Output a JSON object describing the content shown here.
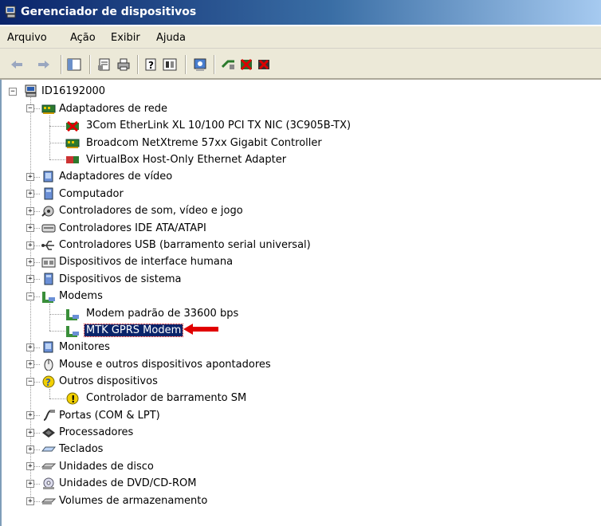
{
  "window": {
    "title": "Gerenciador de dispositivos"
  },
  "menu": [
    "Arquivo",
    "Ação",
    "Exibir",
    "Ajuda"
  ],
  "toolbar": [
    "back-icon",
    "forward-icon",
    "show-hide-icon",
    "properties-icon",
    "print-icon",
    "help-icon",
    "view-icon",
    "scan-hardware-icon",
    "update-driver-icon",
    "disable-icon",
    "uninstall-icon"
  ],
  "tree": {
    "root": "ID16192000",
    "net": {
      "label": "Adaptadores de rede",
      "children": [
        "3Com EtherLink XL 10/100 PCI TX NIC (3C905B-TX)",
        "Broadcom NetXtreme 57xx Gigabit Controller",
        "VirtualBox Host-Only Ethernet Adapter"
      ]
    },
    "video": "Adaptadores de vídeo",
    "computer": "Computador",
    "sound": "Controladores de som, vídeo e jogo",
    "ide": "Controladores IDE ATA/ATAPI",
    "usb": "Controladores USB (barramento serial universal)",
    "hid": "Dispositivos de interface humana",
    "system": "Dispositivos de sistema",
    "modems": {
      "label": "Modems",
      "children": [
        "Modem padrão de 33600 bps",
        "MTK GPRS Modem"
      ]
    },
    "monitors": "Monitores",
    "mouse": "Mouse e outros dispositivos apontadores",
    "other": {
      "label": "Outros dispositivos",
      "children": [
        "Controlador de barramento SM"
      ]
    },
    "ports": "Portas (COM & LPT)",
    "cpu": "Processadores",
    "keyboard": "Teclados",
    "disk": "Unidades de disco",
    "dvd": "Unidades de DVD/CD-ROM",
    "volumes": "Volumes de armazenamento"
  },
  "expand_symbols": {
    "expanded": "−",
    "collapsed": "+"
  }
}
